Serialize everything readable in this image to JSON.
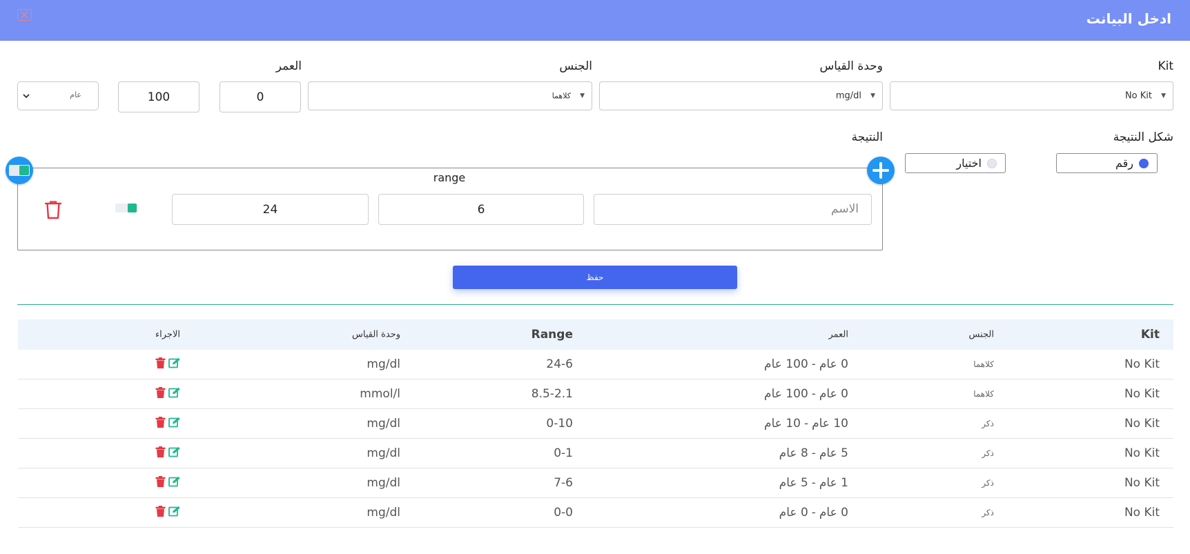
{
  "dialog": {
    "title": "ادخل البيانت"
  },
  "form": {
    "kit": {
      "label": "Kit",
      "value": "No Kit"
    },
    "unit": {
      "label": "وحدة القياس",
      "value": "mg/dl"
    },
    "gender": {
      "label": "الجنس",
      "value": "كلاهما"
    },
    "age": {
      "label": "العمر",
      "from": "0",
      "to": "100",
      "period": "عام"
    },
    "result_shape": {
      "label": "شكل النتيجة",
      "options": [
        {
          "label": "رقم",
          "selected": true
        },
        {
          "label": "اختيار",
          "selected": false
        }
      ]
    },
    "result": {
      "label": "النتيجة",
      "range_title": "range",
      "name_placeholder": "الاسم",
      "low": "6",
      "high": "24"
    },
    "save_label": "حفظ"
  },
  "table": {
    "headers": {
      "kit": "Kit",
      "gender": "الجنس",
      "age": "العمر",
      "range": "Range",
      "unit": "وحدة القياس",
      "actions": "الاجراء"
    },
    "rows": [
      {
        "kit": "No Kit",
        "gender": "كلاهما",
        "age_from": "0 عام",
        "age_to": "100 عام",
        "range": "24-6",
        "unit": "mg/dl"
      },
      {
        "kit": "No Kit",
        "gender": "كلاهما",
        "age_from": "0 عام",
        "age_to": "100 عام",
        "range": "8.5-2.1",
        "unit": "mmol/l"
      },
      {
        "kit": "No Kit",
        "gender": "ذكر",
        "age_from": "10 عام",
        "age_to": "10 عام",
        "range": "0-10",
        "unit": "mg/dl"
      },
      {
        "kit": "No Kit",
        "gender": "ذكر",
        "age_from": "5 عام",
        "age_to": "8 عام",
        "range": "0-1",
        "unit": "mg/dl"
      },
      {
        "kit": "No Kit",
        "gender": "ذكر",
        "age_from": "1 عام",
        "age_to": "5 عام",
        "range": "7-6",
        "unit": "mg/dl"
      },
      {
        "kit": "No Kit",
        "gender": "ذكر",
        "age_from": "0 عام",
        "age_to": "0 عام",
        "range": "0-0",
        "unit": "mg/dl"
      }
    ]
  },
  "colors": {
    "header_bg": "#7690f6",
    "primary": "#4466ee",
    "add_button": "#2196f3",
    "delete": "#e53945",
    "edit": "#1fb88f",
    "toggle_on": "#1fb88f"
  },
  "icons": {
    "close": "close-icon",
    "plus": "plus-icon",
    "trash": "trash-icon",
    "edit": "edit-icon",
    "toggle": "toggle-icon"
  }
}
